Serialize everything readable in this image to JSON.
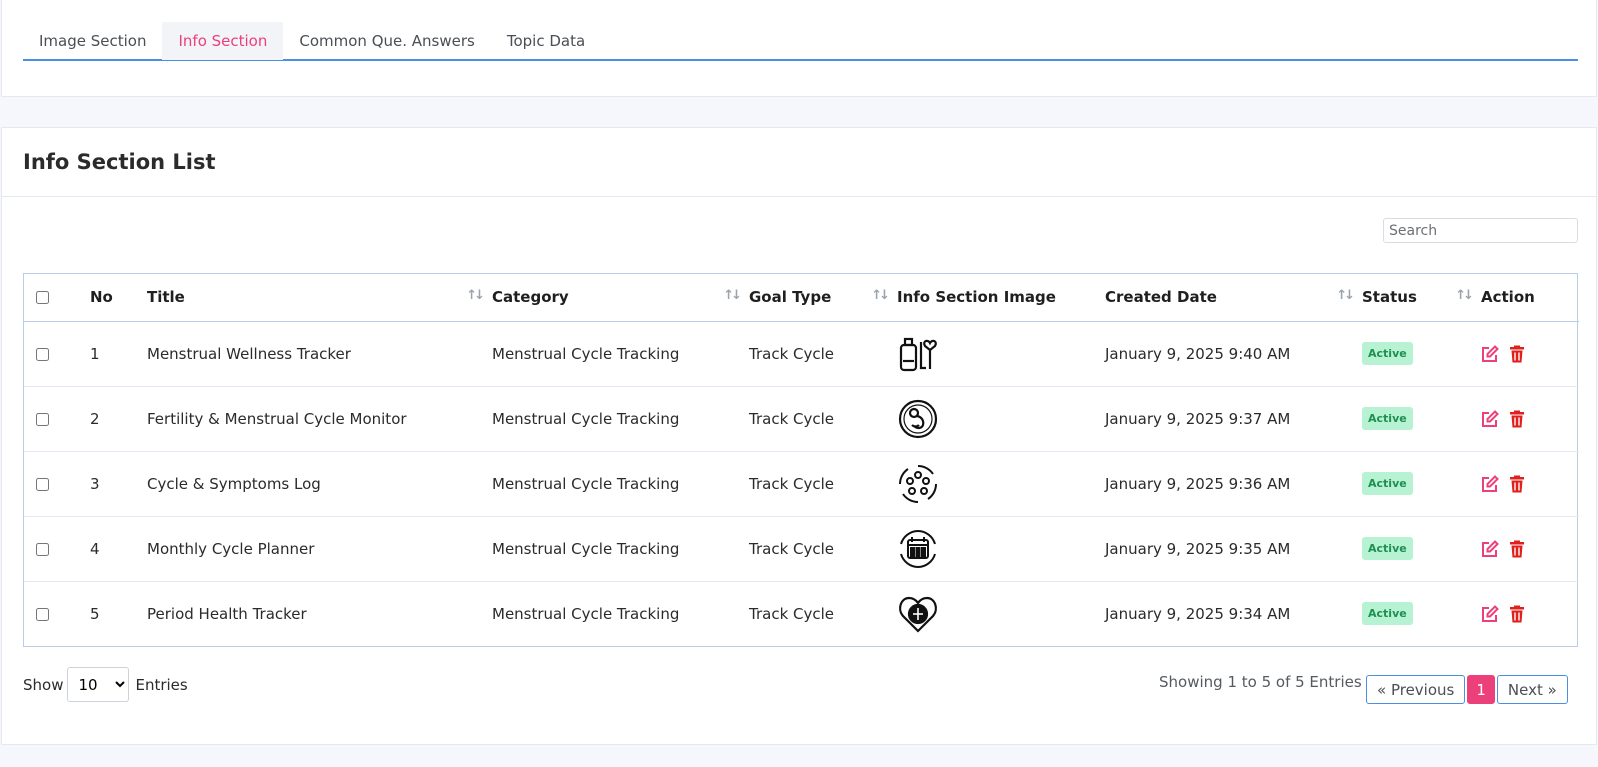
{
  "tabs": [
    {
      "label": "Image Section",
      "active": false
    },
    {
      "label": "Info Section",
      "active": true
    },
    {
      "label": "Common Que. Answers",
      "active": false
    },
    {
      "label": "Topic Data",
      "active": false
    }
  ],
  "list": {
    "title": "Info Section List",
    "search_placeholder": "Search",
    "columns": {
      "no": "No",
      "title": "Title",
      "category": "Category",
      "goal_type": "Goal Type",
      "image": "Info Section Image",
      "created": "Created Date",
      "status": "Status",
      "action": "Action"
    },
    "rows": [
      {
        "no": "1",
        "title": "Menstrual Wellness Tracker",
        "category": "Menstrual Cycle Tracking",
        "goal_type": "Track Cycle",
        "image_icon": "device-heart-icon",
        "created": "January 9, 2025 9:40 AM",
        "status": "Active"
      },
      {
        "no": "2",
        "title": "Fertility & Menstrual Cycle Monitor",
        "category": "Menstrual Cycle Tracking",
        "goal_type": "Track Cycle",
        "image_icon": "fetus-icon",
        "created": "January 9, 2025 9:37 AM",
        "status": "Active"
      },
      {
        "no": "3",
        "title": "Cycle & Symptoms Log",
        "category": "Menstrual Cycle Tracking",
        "goal_type": "Track Cycle",
        "image_icon": "cycle-ring-icon",
        "created": "January 9, 2025 9:36 AM",
        "status": "Active"
      },
      {
        "no": "4",
        "title": "Monthly Cycle Planner",
        "category": "Menstrual Cycle Tracking",
        "goal_type": "Track Cycle",
        "image_icon": "calendar-cycle-icon",
        "created": "January 9, 2025 9:35 AM",
        "status": "Active"
      },
      {
        "no": "5",
        "title": "Period Health Tracker",
        "category": "Menstrual Cycle Tracking",
        "goal_type": "Track Cycle",
        "image_icon": "heart-health-icon",
        "created": "January 9, 2025 9:34 AM",
        "status": "Active"
      }
    ],
    "show_label": "Show",
    "entries_label": "Entries",
    "page_size": "10",
    "page_size_options": [
      "10"
    ],
    "info_text": "Showing 1 to 5 of 5 Entries",
    "prev_label": "« Previous",
    "current_page": "1",
    "next_label": "Next »"
  },
  "colors": {
    "accent": "#ec407a",
    "tab_border": "#4a8fe0",
    "status_bg": "#b7f3d2",
    "status_text": "#1f8f52",
    "edit_icon": "#ec407a",
    "delete_icon": "#e0201c"
  }
}
